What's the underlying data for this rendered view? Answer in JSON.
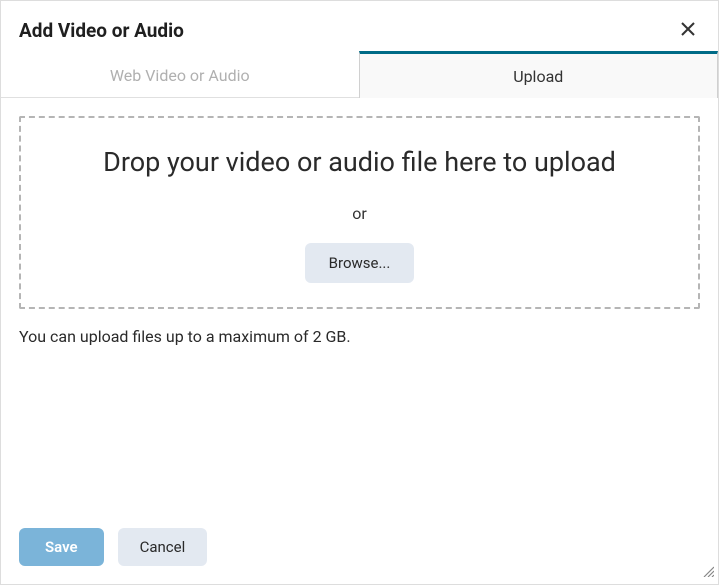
{
  "dialog": {
    "title": "Add Video or Audio"
  },
  "tabs": {
    "web": "Web Video or Audio",
    "upload": "Upload"
  },
  "dropzone": {
    "title": "Drop your video or audio file here to upload",
    "or": "or",
    "browse": "Browse..."
  },
  "helper": "You can upload files up to a maximum of 2 GB.",
  "footer": {
    "save": "Save",
    "cancel": "Cancel"
  }
}
